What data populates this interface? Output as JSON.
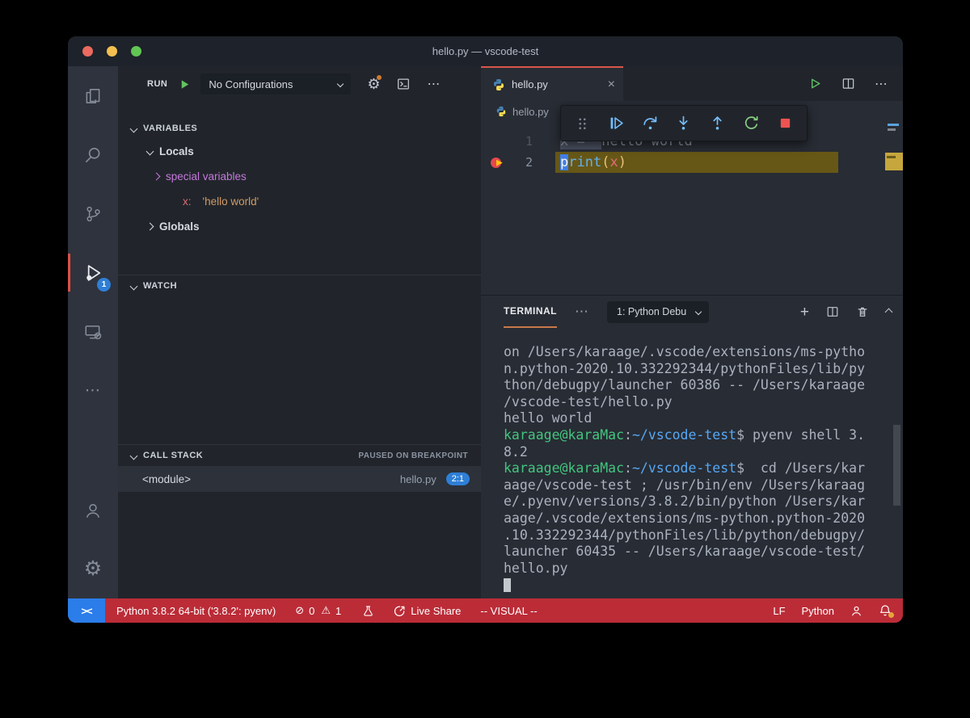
{
  "window": {
    "title": "hello.py — vscode-test"
  },
  "colors": {
    "accent_tab": "#d95649",
    "accent_terminal": "#c97a4a",
    "status_bg": "#bb2c37",
    "remote_bg": "#2b7de9",
    "badge_bg": "#2f7fd6",
    "debug_line_highlight": "#675716"
  },
  "activity_bar": {
    "badge": "1",
    "items": [
      "explorer",
      "search",
      "source-control",
      "run-and-debug",
      "remote-explorer",
      "more",
      "account",
      "settings"
    ]
  },
  "sidebar": {
    "header": {
      "run_label": "RUN",
      "config_dropdown": "No Configurations"
    },
    "variables": {
      "title": "VARIABLES",
      "locals": "Locals",
      "special": "special variables",
      "x_name": "x:",
      "x_value": "'hello world'",
      "globals": "Globals"
    },
    "watch": {
      "title": "WATCH"
    },
    "call_stack": {
      "title": "CALL STACK",
      "status": "PAUSED ON BREAKPOINT",
      "frame_name": "<module>",
      "frame_file": "hello.py",
      "frame_position": "2:1"
    }
  },
  "editor": {
    "tab_label": "hello.py",
    "breadcrumb": "hello.py",
    "code_lines": [
      {
        "number": "1",
        "current": false,
        "breakpoint": false,
        "tokens": [
          {
            "t": "x = '",
            "c": "muted",
            "bg": "sel"
          },
          {
            "t": "hello world'",
            "c": "muted"
          }
        ]
      },
      {
        "number": "2",
        "current": true,
        "breakpoint": true,
        "tokens": [
          {
            "t": "p",
            "c": "fg",
            "bg": "cursor"
          },
          {
            "t": "rint",
            "c": "func"
          },
          {
            "t": "(",
            "c": "bracket"
          },
          {
            "t": "x",
            "c": "var"
          },
          {
            "t": ")",
            "c": "bracket"
          }
        ]
      }
    ]
  },
  "debug_toolbar": {
    "actions": [
      "drag-handle",
      "continue",
      "step-over",
      "step-into",
      "step-out",
      "restart",
      "stop"
    ]
  },
  "panel": {
    "tab": "TERMINAL",
    "dropdown": "1: Python Debu",
    "terminal_lines": [
      [
        {
          "t": "on /Users/karaage/.vscode/extensions/ms-pytho",
          "c": "fg"
        }
      ],
      [
        {
          "t": "n.python-2020.10.332292344/pythonFiles/lib/py",
          "c": "fg"
        }
      ],
      [
        {
          "t": "thon/debugpy/launcher 60386 -- /Users/karaage",
          "c": "fg"
        }
      ],
      [
        {
          "t": "/vscode-test/hello.py",
          "c": "fg"
        }
      ],
      [
        {
          "t": "hello world",
          "c": "fg"
        }
      ],
      [
        {
          "t": "karaage@karaMac",
          "c": "green"
        },
        {
          "t": ":",
          "c": "fg"
        },
        {
          "t": "~/vscode-test",
          "c": "blue"
        },
        {
          "t": "$ pyenv shell 3.",
          "c": "fg"
        }
      ],
      [
        {
          "t": "8.2",
          "c": "fg"
        }
      ],
      [
        {
          "t": "karaage@karaMac",
          "c": "green"
        },
        {
          "t": ":",
          "c": "fg"
        },
        {
          "t": "~/vscode-test",
          "c": "blue"
        },
        {
          "t": "$  cd /Users/kar",
          "c": "fg"
        }
      ],
      [
        {
          "t": "aage/vscode-test ; /usr/bin/env /Users/karaag",
          "c": "fg"
        }
      ],
      [
        {
          "t": "e/.pyenv/versions/3.8.2/bin/python /Users/kar",
          "c": "fg"
        }
      ],
      [
        {
          "t": "aage/.vscode/extensions/ms-python.python-2020",
          "c": "fg"
        }
      ],
      [
        {
          "t": ".10.332292344/pythonFiles/lib/python/debugpy/",
          "c": "fg"
        }
      ],
      [
        {
          "t": "launcher 60435 -- /Users/karaage/vscode-test/",
          "c": "fg"
        }
      ],
      [
        {
          "t": "hello.py",
          "c": "fg"
        }
      ],
      [
        {
          "t": "",
          "c": "cursorblock"
        }
      ]
    ]
  },
  "status_bar": {
    "python_version": "Python 3.8.2 64-bit ('3.8.2': pyenv)",
    "errors": "0",
    "warnings": "1",
    "live_share": "Live Share",
    "vim_mode": "-- VISUAL --",
    "eol": "LF",
    "language": "Python"
  }
}
